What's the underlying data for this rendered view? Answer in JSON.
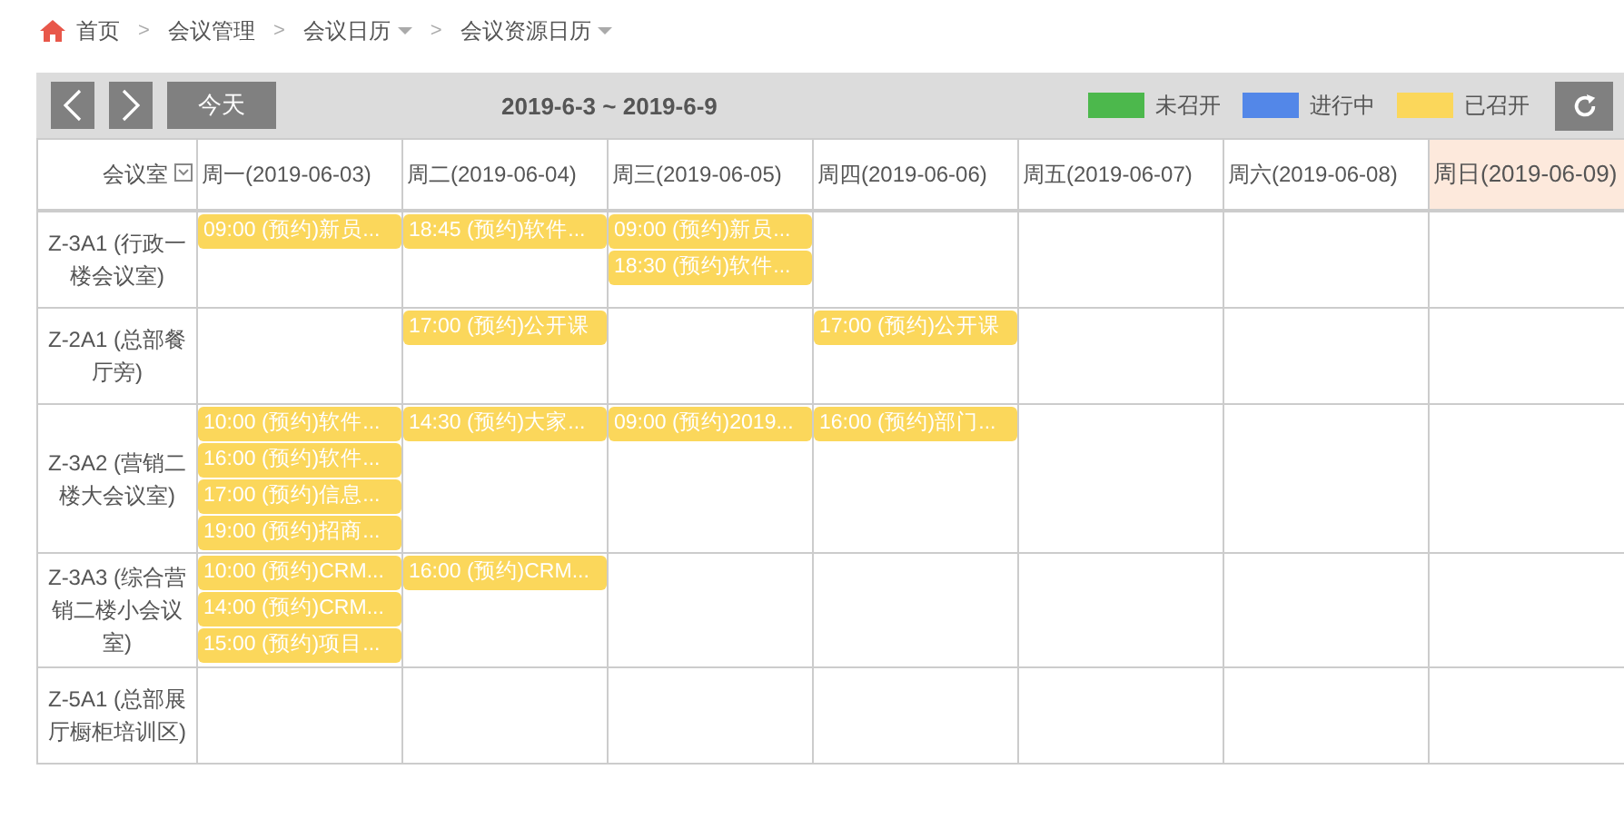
{
  "breadcrumb": [
    {
      "label": "首页",
      "kind": "home",
      "dropdown": false
    },
    {
      "label": "会议管理",
      "kind": "plain",
      "dropdown": false
    },
    {
      "label": "会议日历",
      "kind": "plain",
      "dropdown": true
    },
    {
      "label": "会议资源日历",
      "kind": "plain",
      "dropdown": true
    }
  ],
  "breadcrumb_separator": ">",
  "toolbar": {
    "today_button": "今天",
    "range": "2019-6-3 ~ 2019-6-9",
    "legend": [
      {
        "label": "未召开",
        "color": "#4cb84c"
      },
      {
        "label": "进行中",
        "color": "#5387e8"
      },
      {
        "label": "已召开",
        "color": "#fbd75b"
      }
    ]
  },
  "table": {
    "room_header": "会议室",
    "days": [
      {
        "label": "周一(2019-06-03)",
        "today": false
      },
      {
        "label": "周二(2019-06-04)",
        "today": false
      },
      {
        "label": "周三(2019-06-05)",
        "today": false
      },
      {
        "label": "周四(2019-06-06)",
        "today": false
      },
      {
        "label": "周五(2019-06-07)",
        "today": false
      },
      {
        "label": "周六(2019-06-08)",
        "today": false
      },
      {
        "label": "周日(2019-06-09)",
        "today": true
      }
    ],
    "rows": [
      {
        "room": "Z-3A1 (行政一楼会议室)",
        "cells": [
          [
            {
              "text": "09:00 (预约)新员...",
              "color": "#fbd75b"
            }
          ],
          [
            {
              "text": "18:45 (预约)软件...",
              "color": "#fbd75b"
            }
          ],
          [
            {
              "text": "09:00 (预约)新员...",
              "color": "#fbd75b"
            },
            {
              "text": "18:30 (预约)软件...",
              "color": "#fbd75b"
            }
          ],
          [],
          [],
          [],
          []
        ]
      },
      {
        "room": "Z-2A1 (总部餐厅旁)",
        "cells": [
          [],
          [
            {
              "text": "17:00 (预约)公开课",
              "color": "#fbd75b"
            }
          ],
          [],
          [
            {
              "text": "17:00 (预约)公开课",
              "color": "#fbd75b"
            }
          ],
          [],
          [],
          []
        ]
      },
      {
        "room": "Z-3A2 (营销二楼大会议室)",
        "cells": [
          [
            {
              "text": "10:00 (预约)软件...",
              "color": "#fbd75b"
            },
            {
              "text": "16:00 (预约)软件...",
              "color": "#fbd75b"
            },
            {
              "text": "17:00 (预约)信息...",
              "color": "#fbd75b"
            },
            {
              "text": "19:00 (预约)招商...",
              "color": "#fbd75b"
            }
          ],
          [
            {
              "text": "14:30 (预约)大家...",
              "color": "#fbd75b"
            }
          ],
          [
            {
              "text": "09:00 (预约)2019...",
              "color": "#fbd75b"
            }
          ],
          [
            {
              "text": "16:00 (预约)部门...",
              "color": "#fbd75b"
            }
          ],
          [],
          [],
          []
        ]
      },
      {
        "room": "Z-3A3 (综合营销二楼小会议室)",
        "cells": [
          [
            {
              "text": "10:00 (预约)CRM...",
              "color": "#fbd75b"
            },
            {
              "text": "14:00 (预约)CRM...",
              "color": "#fbd75b"
            },
            {
              "text": "15:00 (预约)项目...",
              "color": "#fbd75b"
            }
          ],
          [
            {
              "text": "16:00 (预约)CRM...",
              "color": "#fbd75b"
            }
          ],
          [],
          [],
          [],
          [],
          []
        ]
      },
      {
        "room": "Z-5A1 (总部展厅橱柜培训区)",
        "cells": [
          [],
          [],
          [],
          [],
          [],
          [],
          []
        ]
      }
    ]
  }
}
